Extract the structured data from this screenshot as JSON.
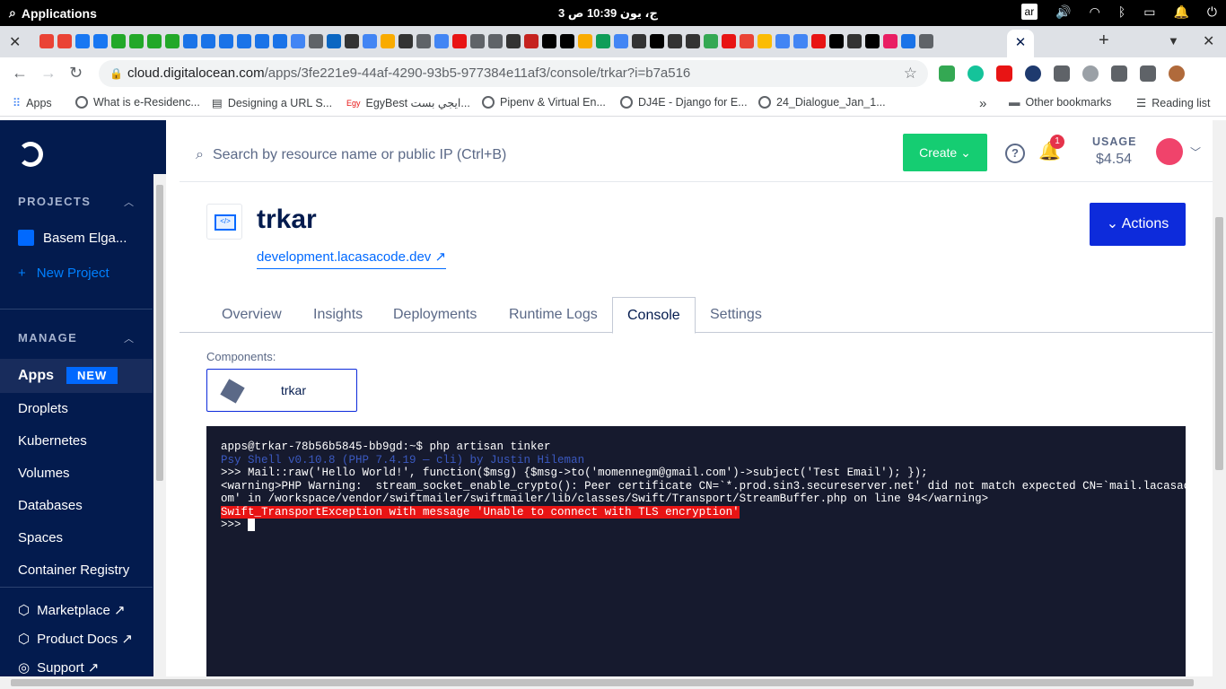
{
  "system": {
    "apps_label": "Applications",
    "clock": "3 ج، يون  10:39 ص",
    "lang": "ar"
  },
  "browser": {
    "url_domain": "cloud.digitalocean.com",
    "url_path": "/apps/3fe221e9-44af-4290-93b5-977384e11af3/console/trkar?i=b7a516",
    "favicon_colors": [
      "#ea4335",
      "#ea4335",
      "#1877f2",
      "#1877f2",
      "#22a829",
      "#22a829",
      "#22a829",
      "#22a829",
      "#1a73e8",
      "#1a73e8",
      "#1a73e8",
      "#1a73e8",
      "#1a73e8",
      "#1a73e8",
      "#4285f4",
      "#5f6368",
      "#0a66c2",
      "#333333",
      "#4285f4",
      "#f9ab00",
      "#333333",
      "#5f6368",
      "#4285f4",
      "#e81414",
      "#5f6368",
      "#5f6368",
      "#333333",
      "#c5221f",
      "#000000",
      "#000000",
      "#f9ab00",
      "#0f9d58",
      "#4285f4",
      "#333333",
      "#000000",
      "#333333",
      "#333333",
      "#34a853",
      "#e81414",
      "#ea4335",
      "#fbbc04",
      "#4285f4",
      "#4285f4",
      "#e81414",
      "#000000",
      "#333333",
      "#000000",
      "#e91e63",
      "#1a73e8",
      "#5f6368"
    ],
    "bookmarks": [
      {
        "label": "Apps"
      },
      {
        "label": "What is e-Residenc..."
      },
      {
        "label": "Designing a URL S..."
      },
      {
        "label": "EgyBest ايجي بست..."
      },
      {
        "label": "Pipenv & Virtual En..."
      },
      {
        "label": "DJ4E - Django for E..."
      },
      {
        "label": "24_Dialogue_Jan_1..."
      }
    ],
    "more_bookmarks": "»",
    "other_bookmarks": "Other bookmarks",
    "reading_list": "Reading list",
    "ext_count": "3"
  },
  "sidebar": {
    "projects_heading": "PROJECTS",
    "project_name": "Basem Elga...",
    "new_project": "New Project",
    "manage_heading": "MANAGE",
    "items": [
      {
        "label": "Apps"
      },
      {
        "label": "Droplets"
      },
      {
        "label": "Kubernetes"
      },
      {
        "label": "Volumes"
      },
      {
        "label": "Databases"
      },
      {
        "label": "Spaces"
      },
      {
        "label": "Container Registry"
      }
    ],
    "apps_badge": "NEW",
    "footer": [
      {
        "label": "Marketplace ↗"
      },
      {
        "label": "Product Docs ↗"
      },
      {
        "label": "Support ↗"
      }
    ]
  },
  "header": {
    "search_placeholder": "Search by resource name or public IP (Ctrl+B)",
    "create_label": "Create",
    "notif_count": "1",
    "usage_label": "USAGE",
    "usage_value": "$4.54"
  },
  "app": {
    "name": "trkar",
    "link": "development.lacasacode.dev",
    "actions_label": "Actions",
    "tabs": [
      {
        "label": "Overview"
      },
      {
        "label": "Insights"
      },
      {
        "label": "Deployments"
      },
      {
        "label": "Runtime Logs"
      },
      {
        "label": "Console"
      },
      {
        "label": "Settings"
      }
    ],
    "components_label": "Components:",
    "component_name": "trkar"
  },
  "console": {
    "lines": [
      "apps@trkar-78b56b5845-bb9gd:~$ php artisan tinker",
      "",
      "Psy Shell v0.10.8 (PHP 7.4.19 — cli) by Justin Hileman",
      ">>> Mail::raw('Hello World!', function($msg) {$msg->to('momennegm@gmail.com')->subject('Test Email'); });",
      "<warning>PHP Warning:  stream_socket_enable_crypto(): Peer certificate CN=`*.prod.sin3.secureserver.net' did not match expected CN=`mail.lacasacode.c",
      "om' in /workspace/vendor/swiftmailer/swiftmailer/lib/classes/Swift/Transport/StreamBuffer.php on line 94</warning>",
      "Swift_TransportException with message 'Unable to connect with TLS encryption'",
      ">>> "
    ]
  }
}
